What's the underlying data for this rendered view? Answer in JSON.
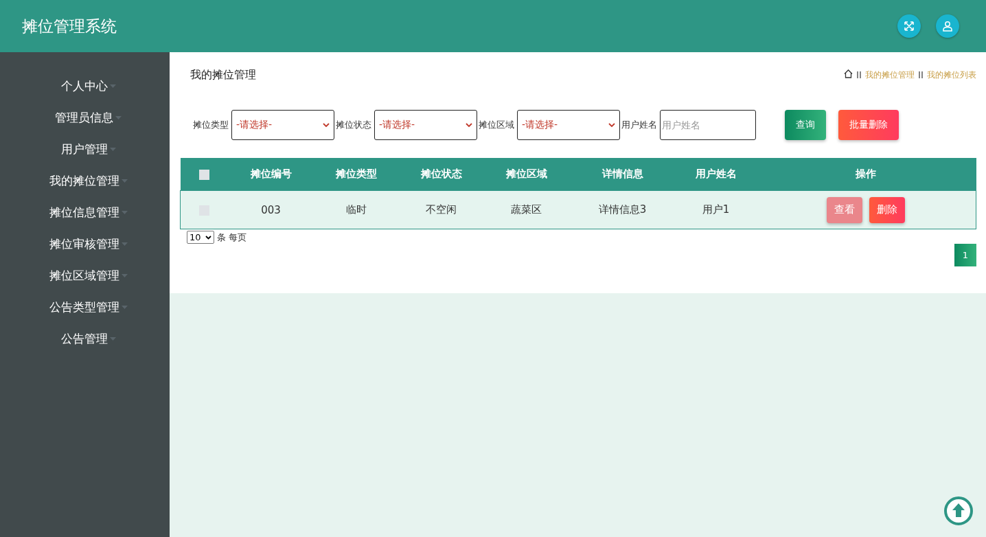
{
  "header": {
    "title": "摊位管理系统"
  },
  "sidebar": {
    "items": [
      {
        "label": "个人中心"
      },
      {
        "label": "管理员信息"
      },
      {
        "label": "用户管理"
      },
      {
        "label": "我的摊位管理"
      },
      {
        "label": "摊位信息管理"
      },
      {
        "label": "摊位审核管理"
      },
      {
        "label": "摊位区域管理"
      },
      {
        "label": "公告类型管理"
      },
      {
        "label": "公告管理"
      }
    ]
  },
  "page_title": "我的摊位管理",
  "breadcrumb": [
    "我的摊位管理",
    "我的摊位列表"
  ],
  "filters": [
    {
      "kind": "select",
      "label": "摊位类型",
      "value": "-请选择-"
    },
    {
      "kind": "select",
      "label": "摊位状态",
      "value": "-请选择-"
    },
    {
      "kind": "select",
      "label": "摊位区域",
      "value": "-请选择-"
    },
    {
      "kind": "input",
      "label": "用户姓名",
      "placeholder": "用户姓名"
    }
  ],
  "actions": [
    {
      "kind": "primary",
      "label": "查询"
    },
    {
      "kind": "danger",
      "label": "批量删除"
    }
  ],
  "table": {
    "select_all": {
      "checked": false
    },
    "columns": [
      "摊位编号",
      "摊位类型",
      "摊位状态",
      "摊位区域",
      "详情信息",
      "用户姓名",
      "操作"
    ],
    "rows": [
      {
        "checked": false,
        "cells": [
          "003",
          "临时",
          "不空闲",
          "蔬菜区",
          "详情信息3",
          "用户1"
        ],
        "actions": [
          {
            "kind": "view",
            "label": "查看"
          },
          {
            "kind": "danger",
            "label": "删除"
          }
        ]
      }
    ]
  },
  "page_size": {
    "value": "10",
    "suffix": "条 每页"
  },
  "pagination": [
    {
      "label": "1",
      "selected": true
    }
  ]
}
